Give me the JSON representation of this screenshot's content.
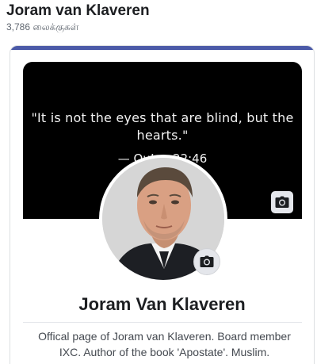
{
  "header": {
    "page_name": "Joram van Klaveren",
    "likes": "3,786 லைக்குகள்"
  },
  "cover": {
    "quote": "\"It is not the eyes that are blind, but the hearts.\"",
    "attribution": "— Qu’an 22:46",
    "camera_icon": "camera-icon"
  },
  "profile": {
    "avatar_icon": "avatar",
    "camera_icon": "camera-icon",
    "name": "Joram Van Klaveren",
    "about": "Offical page of Joram van Klaveren. Board member IXC. Author of the book 'Apostate'. Muslim."
  },
  "colors": {
    "accent_bar": "#4b5aa8",
    "cover_bg": "#000000",
    "text_primary": "#1c1e21",
    "text_secondary": "#606770"
  }
}
